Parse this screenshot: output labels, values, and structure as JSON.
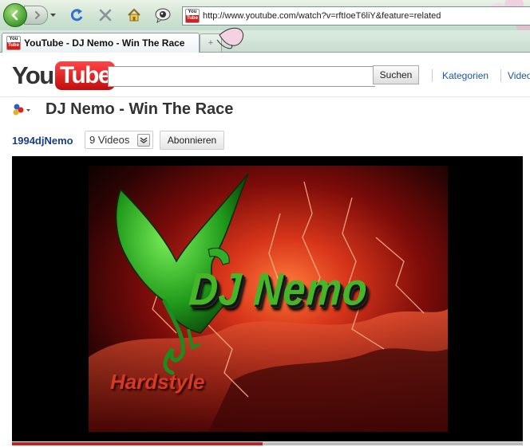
{
  "browser": {
    "address_url": "http://www.youtube.com/watch?v=rftIoeT6liY&feature=related",
    "tab_title": "YouTube - DJ Nemo - Win The Race",
    "favicon_you": "You",
    "favicon_tube": "Tube",
    "new_tab_glyph": "+"
  },
  "header": {
    "logo_you": "You",
    "logo_tube": "Tube",
    "search_placeholder": "",
    "search_button": "Suchen",
    "links": [
      "Kategorien",
      "Videos"
    ]
  },
  "watch": {
    "title": "DJ Nemo - Win The Race",
    "channel": "1994djNemo",
    "video_count": "9 Videos",
    "subscribe_button": "Abonnieren"
  },
  "player": {
    "overlay_title": "DJ Nemo",
    "overlay_subtitle": "Hardstyle",
    "progress": 0.49
  },
  "colors": {
    "link": "#1a55a6",
    "channel": "#1a3e8c",
    "brand_red": "#d41f1f",
    "progress": "#c71f1f"
  },
  "icons": {
    "back": "back-arrow-icon",
    "forward": "forward-arrow-icon",
    "refresh": "refresh-icon",
    "stop": "stop-icon",
    "home": "home-icon",
    "feeds": "eye-feed-icon",
    "playlist": "playlist-dots-icon"
  }
}
